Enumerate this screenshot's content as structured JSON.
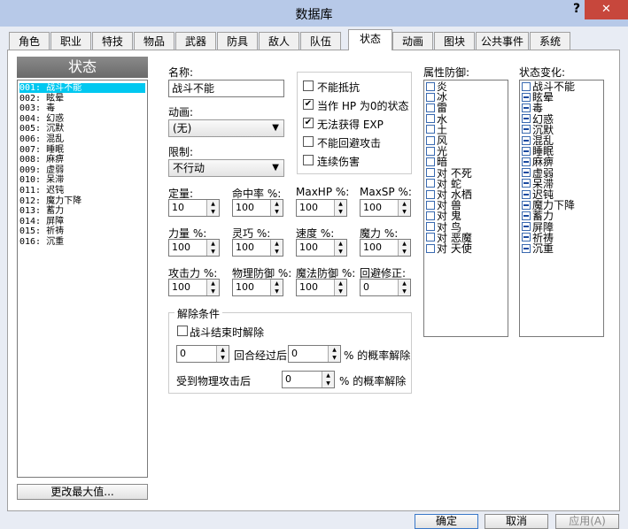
{
  "window": {
    "title": "数据库",
    "help": "?",
    "close": "✕"
  },
  "tabs": [
    "角色",
    "职业",
    "特技",
    "物品",
    "武器",
    "防具",
    "敌人",
    "队伍",
    "状态",
    "动画",
    "图块",
    "公共事件",
    "系统"
  ],
  "active_tab": "状态",
  "list_header": "状态",
  "state_list": [
    "001: 战斗不能",
    "002: 眩晕",
    "003: 毒",
    "004: 幻惑",
    "005: 沉默",
    "006: 混乱",
    "007: 睡眠",
    "008: 麻痹",
    "009: 虚弱",
    "010: 呆滞",
    "011: 迟钝",
    "012: 魔力下降",
    "013: 蓄力",
    "014: 屏障",
    "015: 祈祷",
    "016: 沉重"
  ],
  "change_max_button": "更改最大值...",
  "form": {
    "name_label": "名称:",
    "name_value": "战斗不能",
    "animation_label": "动画:",
    "animation_value": "(无)",
    "restriction_label": "限制:",
    "restriction_value": "不行动",
    "checkboxes": [
      {
        "label": "不能抵抗",
        "checked": false
      },
      {
        "label": "当作 HP 为0的状态",
        "checked": true
      },
      {
        "label": "无法获得 EXP",
        "checked": true
      },
      {
        "label": "不能回避攻击",
        "checked": false
      },
      {
        "label": "连续伤害",
        "checked": false
      }
    ],
    "fields": [
      {
        "label": "定量:",
        "value": "10"
      },
      {
        "label": "命中率 %:",
        "value": "100"
      },
      {
        "label": "MaxHP %:",
        "value": "100"
      },
      {
        "label": "MaxSP %:",
        "value": "100"
      },
      {
        "label": "力量 %:",
        "value": "100"
      },
      {
        "label": "灵巧 %:",
        "value": "100"
      },
      {
        "label": "速度 %:",
        "value": "100"
      },
      {
        "label": "魔力 %:",
        "value": "100"
      },
      {
        "label": "攻击力 %:",
        "value": "100"
      },
      {
        "label": "物理防御 %:",
        "value": "100"
      },
      {
        "label": "魔法防御 %:",
        "value": "100"
      },
      {
        "label": "回避修正:",
        "value": "0"
      }
    ],
    "release": {
      "group_label": "解除条件",
      "battle_end_label": "战斗结束时解除",
      "turns_value": "0",
      "turns_label": "回合经过后",
      "turns_pct_value": "0",
      "turns_pct_label": "% 的概率解除",
      "phys_label": "受到物理攻击后",
      "phys_pct_value": "0",
      "phys_pct_label": "% 的概率解除"
    }
  },
  "element_defense": {
    "label": "属性防御:",
    "items": [
      "炎",
      "冰",
      "雷",
      "水",
      "土",
      "风",
      "光",
      "暗",
      "对 不死",
      "对 蛇",
      "对 水栖",
      "对 兽",
      "对 鬼",
      "对 鸟",
      "对 恶魔",
      "对 天使"
    ]
  },
  "state_change": {
    "label": "状态变化:",
    "items": [
      "战斗不能",
      "眩晕",
      "毒",
      "幻惑",
      "沉默",
      "混乱",
      "睡眠",
      "麻痹",
      "虚弱",
      "呆滞",
      "迟钝",
      "魔力下降",
      "蓄力",
      "屏障",
      "祈祷",
      "沉重"
    ]
  },
  "buttons": {
    "ok": "确定",
    "cancel": "取消",
    "apply": "应用(A)"
  },
  "colors": {
    "selection": "#00c8f0",
    "titlebar": "#b7c9e8",
    "close": "#c7473c"
  }
}
